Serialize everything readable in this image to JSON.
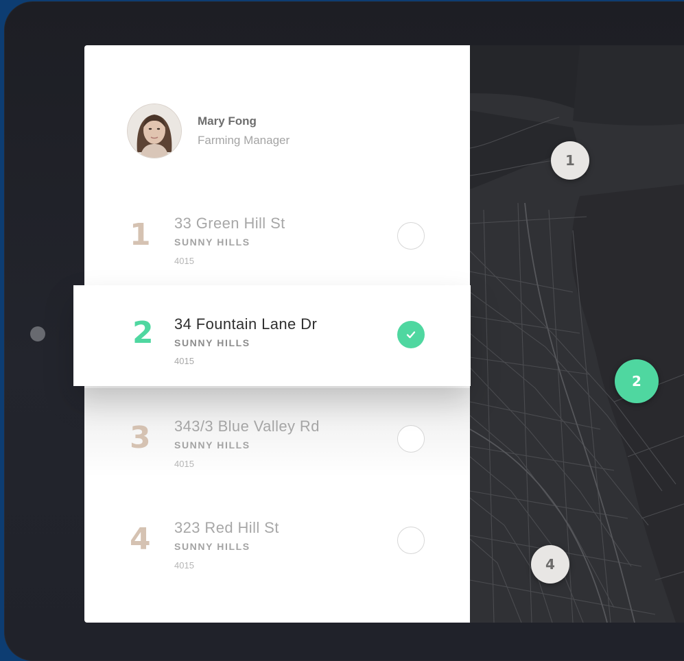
{
  "user": {
    "name": "Mary Fong",
    "role": "Farming Manager"
  },
  "stops": [
    {
      "number": "1",
      "street": "33 Green Hill St",
      "suburb": "SUNNY HILLS",
      "postcode": "4015",
      "checked": false
    },
    {
      "number": "2",
      "street": "34 Fountain Lane Dr",
      "suburb": "SUNNY HILLS",
      "postcode": "4015",
      "checked": true
    },
    {
      "number": "3",
      "street": "343/3 Blue Valley Rd",
      "suburb": "SUNNY HILLS",
      "postcode": "4015",
      "checked": false
    },
    {
      "number": "4",
      "street": "323 Red Hill St",
      "suburb": "SUNNY HILLS",
      "postcode": "4015",
      "checked": false
    }
  ],
  "map": {
    "markers": [
      {
        "label": "1",
        "active": false
      },
      {
        "label": "2",
        "active": true
      },
      {
        "label": "4",
        "active": false
      }
    ]
  },
  "colors": {
    "accent": "#4fd7a0",
    "device": "#1f2128",
    "background": "#0d3d72",
    "map": "#2f3034",
    "number_inactive": "#d5c2b2"
  }
}
